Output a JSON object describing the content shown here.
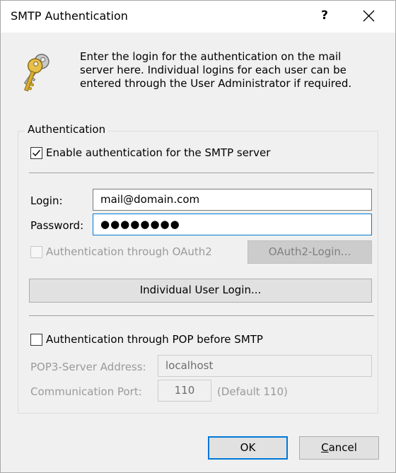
{
  "window": {
    "title": "SMTP Authentication",
    "help_label": "?"
  },
  "intro_text": "Enter the login for the authentication on the mail server here. Individual logins for each user can be entered through the User Administrator if required.",
  "authentication": {
    "group_label": "Authentication",
    "enable_smtp_auth": {
      "label": "Enable authentication for the SMTP server",
      "checked": true
    },
    "login": {
      "label": "Login:",
      "value": "mail@domain.com"
    },
    "password": {
      "label": "Password:",
      "value": "●●●●●●●●"
    },
    "oauth2": {
      "label": "Authentication through OAuth2",
      "checked": false,
      "enabled": false,
      "button_label": "OAuth2-Login..."
    },
    "individual_login_button": "Individual User Login...",
    "pop_before_smtp": {
      "label": "Authentication through POP before SMTP",
      "checked": false
    },
    "pop3_server": {
      "label": "POP3-Server Address:",
      "value": "localhost"
    },
    "comm_port": {
      "label": "Communication Port:",
      "value": "110",
      "hint": "(Default 110)"
    }
  },
  "buttons": {
    "ok": "OK",
    "cancel_first": "C",
    "cancel_rest": "ancel"
  },
  "colors": {
    "accent": "#0078d7",
    "dialog_bg": "#f0f0f0",
    "disabled_text": "#9a9a9a"
  }
}
